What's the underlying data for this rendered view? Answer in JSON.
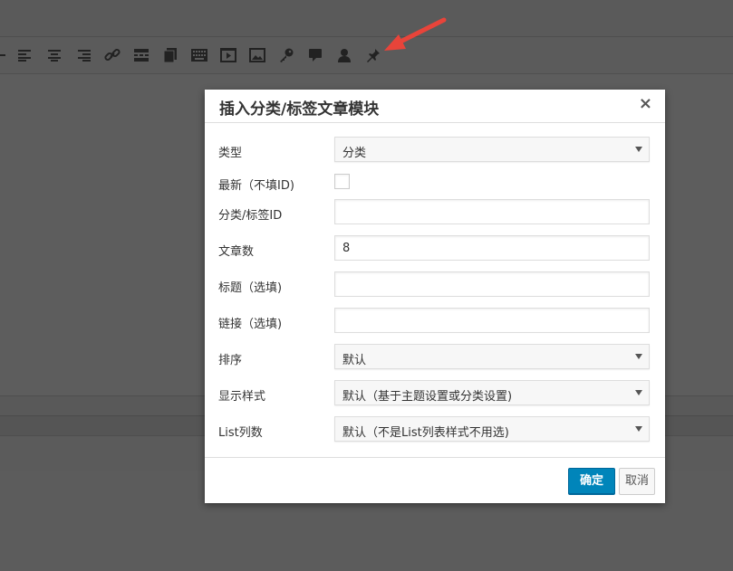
{
  "dialog": {
    "title": "插入分类/标签文章模块",
    "close": "×",
    "fields": {
      "type": {
        "label": "类型",
        "value": "分类"
      },
      "latest": {
        "label": "最新（不填ID)",
        "checked": false
      },
      "category_tag_id": {
        "label": "分类/标签ID",
        "value": ""
      },
      "post_count": {
        "label": "文章数",
        "value": "8"
      },
      "title": {
        "label": "标题（选填)",
        "value": ""
      },
      "link": {
        "label": "链接（选填)",
        "value": ""
      },
      "sort": {
        "label": "排序",
        "value": "默认"
      },
      "display_style": {
        "label": "显示样式",
        "value": "默认（基于主题设置或分类设置)"
      },
      "list_columns": {
        "label": "List列数",
        "value": "默认（不是List列表样式不用选)"
      }
    },
    "buttons": {
      "ok": "确定",
      "cancel": "取消"
    }
  },
  "toolbar": {
    "icons": [
      "strikethrough-icon",
      "align-left-icon",
      "align-center-icon",
      "align-right-icon",
      "link-icon",
      "more-tag-icon",
      "page-icon",
      "keyboard-icon",
      "video-icon",
      "image-icon",
      "key-icon",
      "comment-icon",
      "user-icon",
      "pin-icon"
    ]
  },
  "colors": {
    "primary_button": "#0085ba",
    "annotation_arrow": "#e8443a",
    "overlay": "#5c5c5c"
  }
}
